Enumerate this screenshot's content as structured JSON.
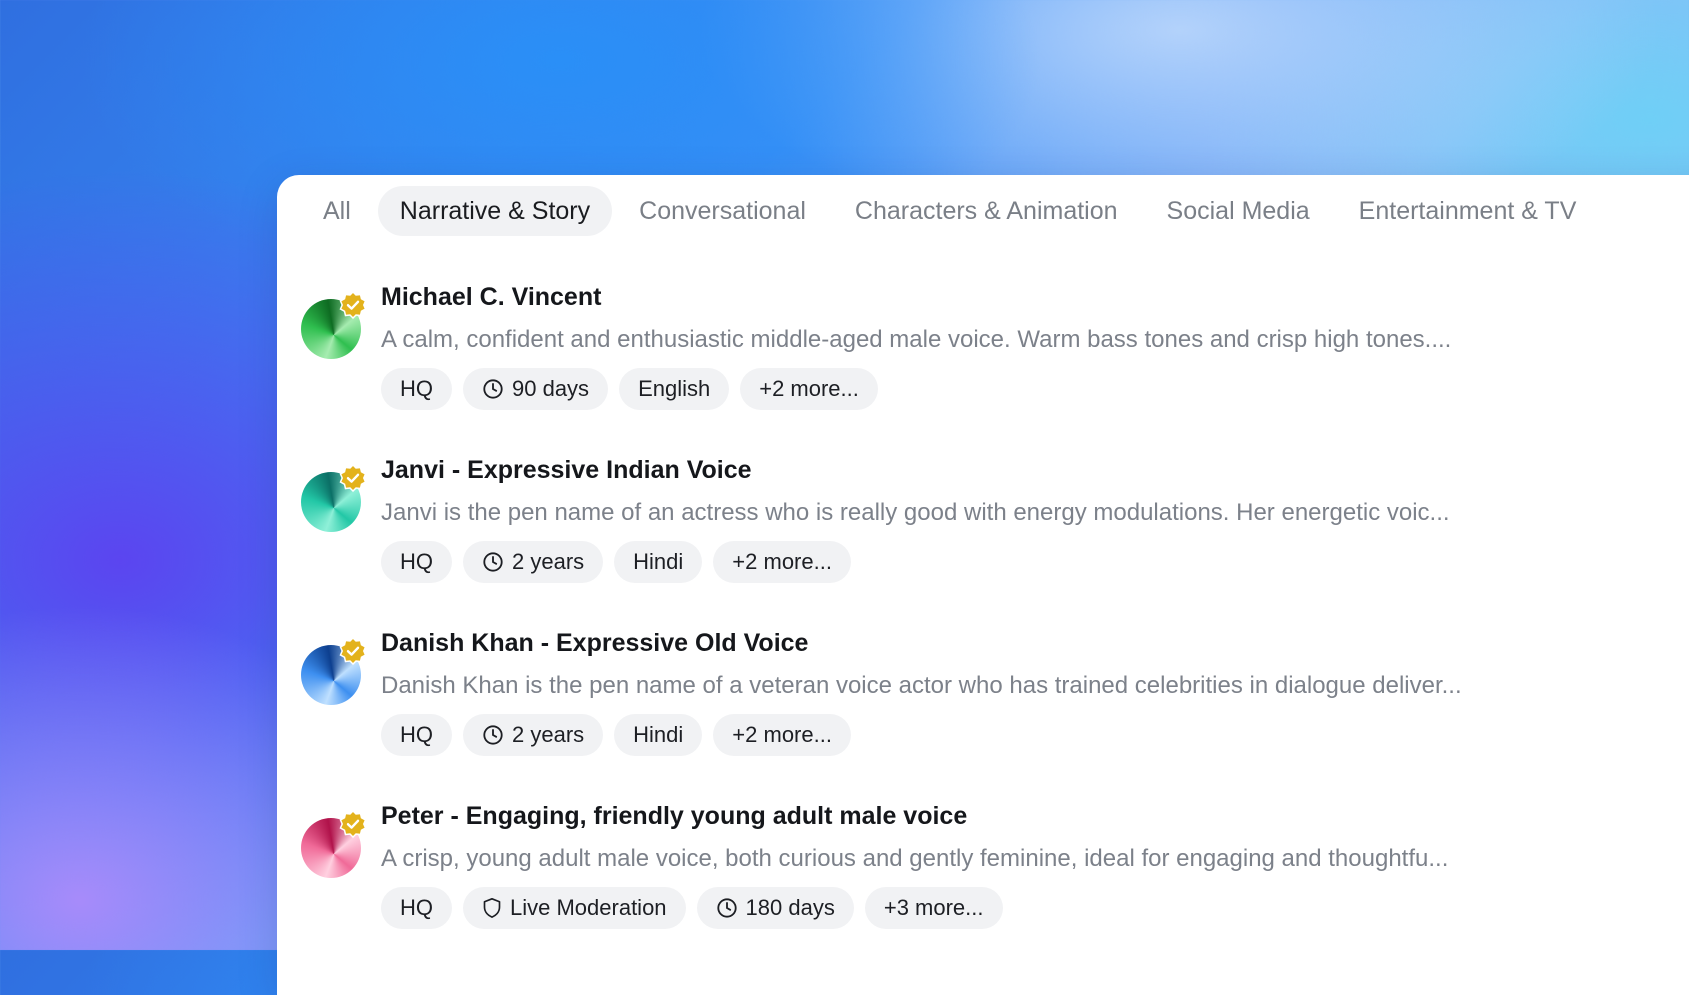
{
  "tabs": [
    "All",
    "Narrative & Story",
    "Conversational",
    "Characters & Animation",
    "Social Media",
    "Entertainment & TV"
  ],
  "active_tab": "Narrative & Story",
  "voices": [
    {
      "name": "Michael C. Vincent",
      "description": "A calm, confident and enthusiastic middle-aged male voice. Warm bass tones and crisp high tones....",
      "avatar_colors": [
        "#a6ecb0",
        "#2fbf4f",
        "#0e6b22"
      ],
      "tags": [
        {
          "label": "HQ",
          "icon": ""
        },
        {
          "label": "90 days",
          "icon": "clock-icon"
        },
        {
          "label": "English",
          "icon": ""
        },
        {
          "label": "+2 more...",
          "icon": ""
        }
      ]
    },
    {
      "name": "Janvi - Expressive Indian Voice",
      "description": "Janvi is the pen name of an actress who is really good with energy modulations. Her energetic voic...",
      "avatar_colors": [
        "#8ff0d8",
        "#22c7a6",
        "#0b6f66"
      ],
      "tags": [
        {
          "label": "HQ",
          "icon": ""
        },
        {
          "label": "2 years",
          "icon": "clock-icon"
        },
        {
          "label": "Hindi",
          "icon": ""
        },
        {
          "label": "+2 more...",
          "icon": ""
        }
      ]
    },
    {
      "name": "Danish Khan - Expressive Old Voice",
      "description": "Danish Khan is the pen name of a veteran voice actor who has trained celebrities in dialogue deliver...",
      "avatar_colors": [
        "#bfe0ff",
        "#3d8ff0",
        "#0d3f8f"
      ],
      "tags": [
        {
          "label": "HQ",
          "icon": ""
        },
        {
          "label": "2 years",
          "icon": "clock-icon"
        },
        {
          "label": "Hindi",
          "icon": ""
        },
        {
          "label": "+2 more...",
          "icon": ""
        }
      ]
    },
    {
      "name": "Peter - Engaging, friendly young adult male voice",
      "description": "A crisp, young adult male voice, both curious and gently feminine, ideal for engaging and thoughtfu...",
      "avatar_colors": [
        "#ffd0e0",
        "#f06a98",
        "#b0124a"
      ],
      "tags": [
        {
          "label": "HQ",
          "icon": ""
        },
        {
          "label": "Live Moderation",
          "icon": "shield-icon"
        },
        {
          "label": "180 days",
          "icon": "clock-icon"
        },
        {
          "label": "+3 more...",
          "icon": ""
        }
      ]
    }
  ],
  "colors": {
    "verified_badge": "#e3b21c",
    "tag_background": "#f1f2f4",
    "active_tab_background": "#f1f2f4"
  }
}
